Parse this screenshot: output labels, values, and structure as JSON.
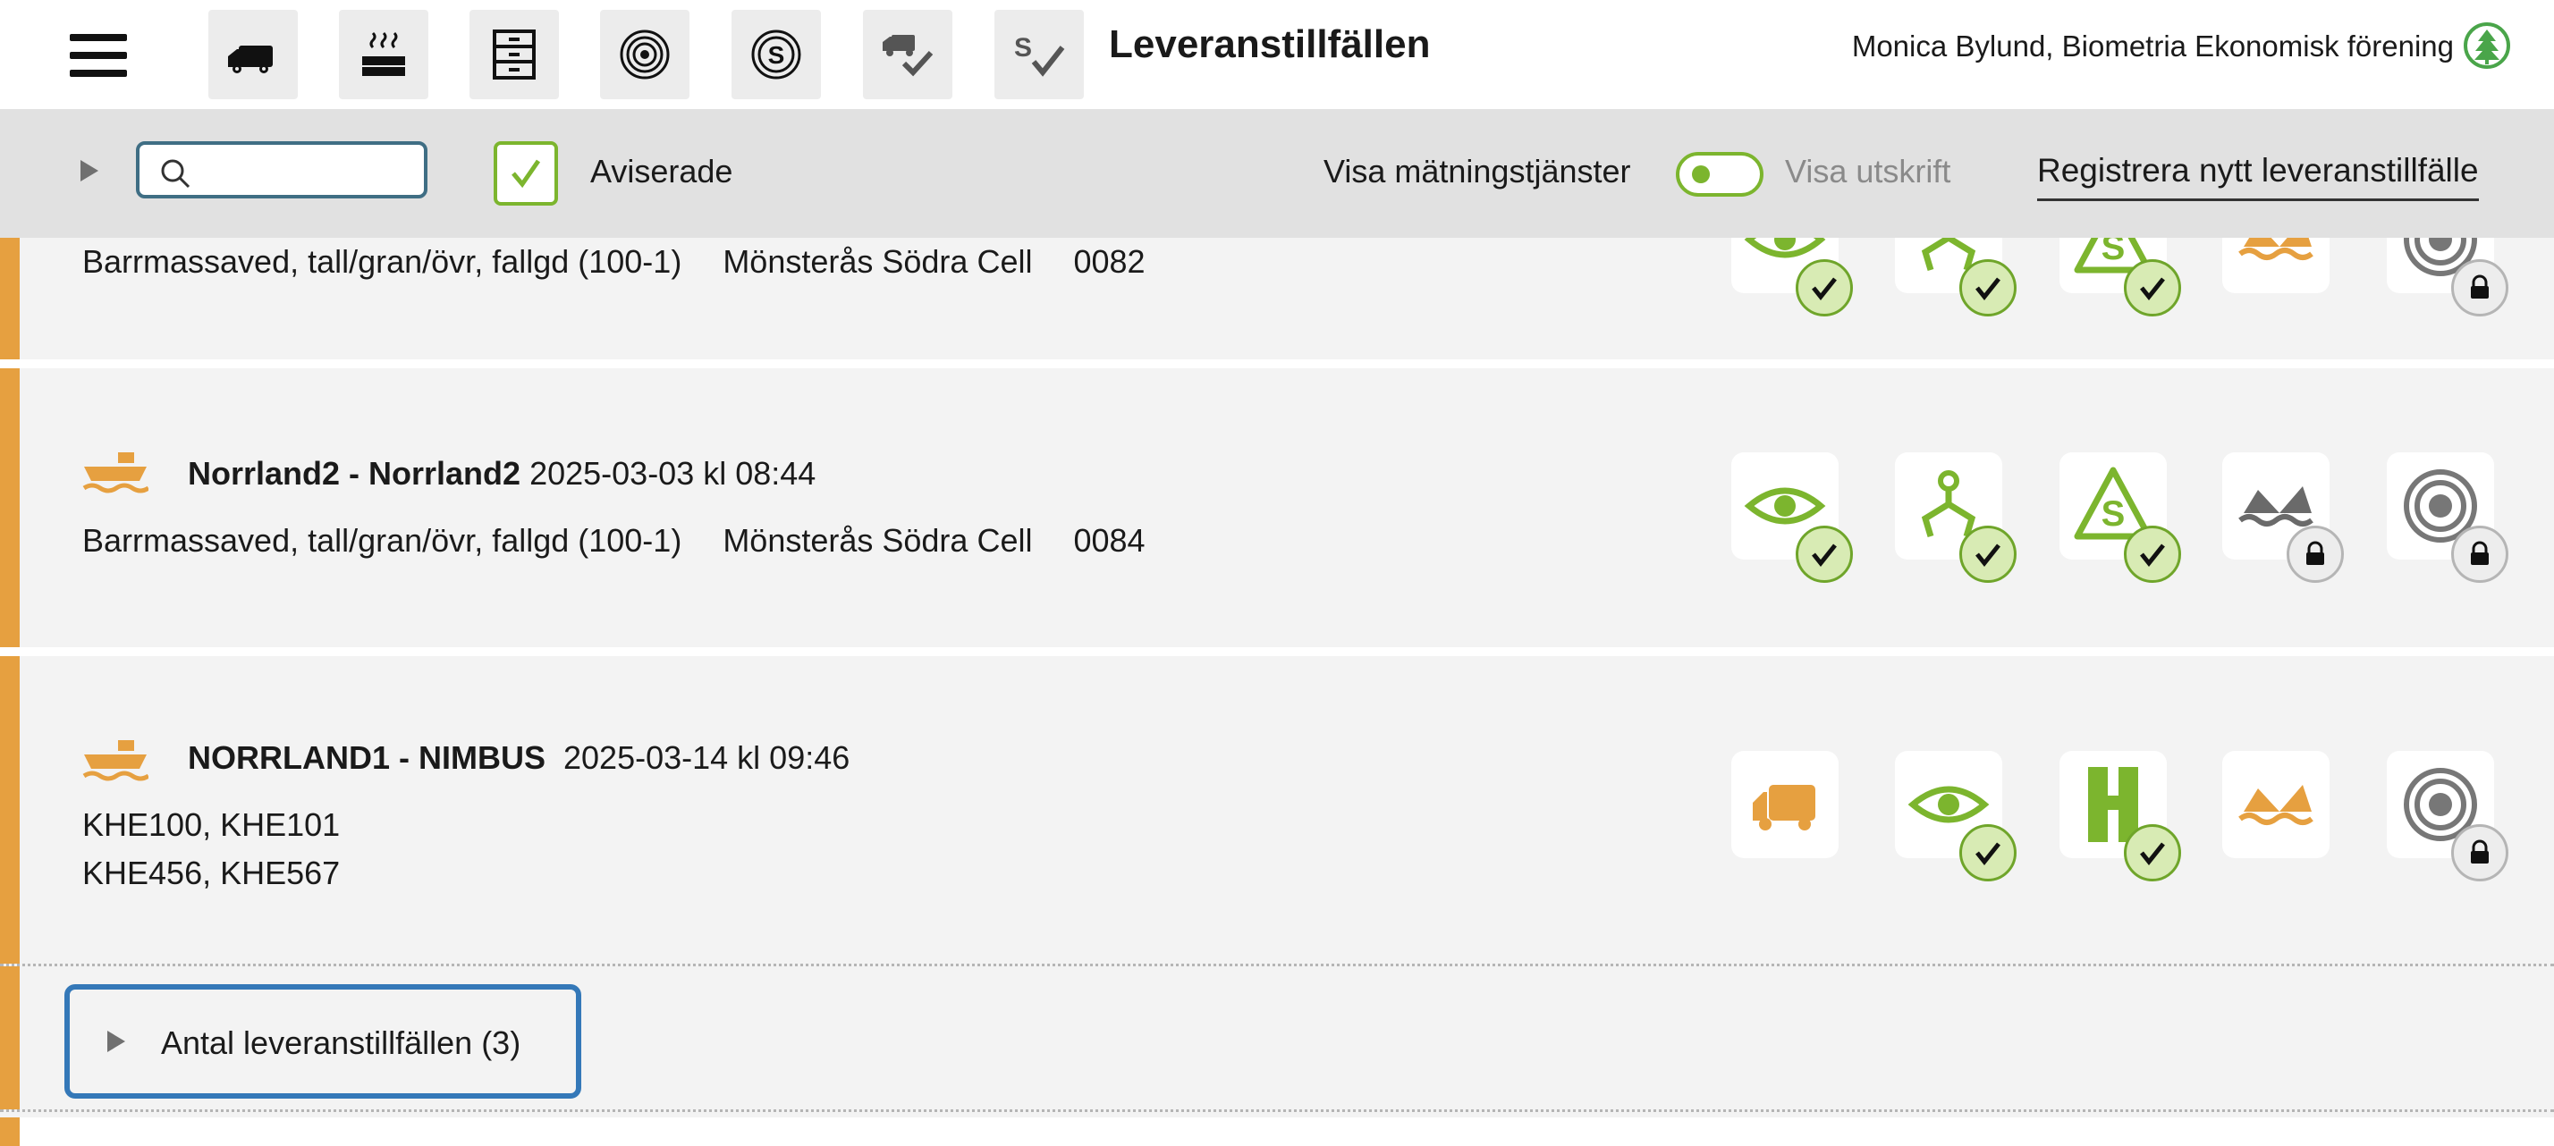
{
  "header": {
    "title": "Leveranstillfällen",
    "user": "Monica Bylund, Biometria Ekonomisk förening",
    "nav_icons": [
      "truck-icon",
      "steam-icon",
      "cabinet-icon",
      "target-icon",
      "coin-icon",
      "truck-check-icon",
      "sign-check-icon"
    ]
  },
  "toolbar": {
    "search_placeholder": "",
    "checkbox_label": "Aviserade",
    "checkbox_checked": true,
    "measure_label": "Visa mätningstjänster",
    "toggle_on": true,
    "print_label": "Visa utskrift",
    "register_link": "Registrera nytt leveranstillfälle"
  },
  "rows": [
    {
      "product": "Barrmassaved, tall/gran/övr, fallgd (100-1)",
      "location": "Mönsterås Södra Cell",
      "code": "0082",
      "statuses": [
        "check",
        "check",
        "check",
        "none",
        "lock"
      ]
    },
    {
      "name": "Norrland2 - Norrland2",
      "datetime": "2025-03-03 kl 08:44",
      "product": "Barrmassaved, tall/gran/övr, fallgd (100-1)",
      "location": "Mönsterås Södra Cell",
      "code": "0084",
      "statuses": [
        "check",
        "check",
        "check",
        "lock",
        "lock"
      ]
    },
    {
      "name": "NORRLAND1 - NIMBUS",
      "datetime": "2025-03-14 kl 09:46",
      "line1": "KHE100, KHE101",
      "line2": "KHE456, KHE567",
      "statuses": [
        "none",
        "check",
        "check",
        "none",
        "lock"
      ]
    }
  ],
  "summary": {
    "label": "Antal leveranstillfällen (3)"
  },
  "colors": {
    "accent": "#e6a040",
    "green": "#7cb52e",
    "focus_blue": "#3478b8",
    "search_border": "#3f6e84"
  }
}
